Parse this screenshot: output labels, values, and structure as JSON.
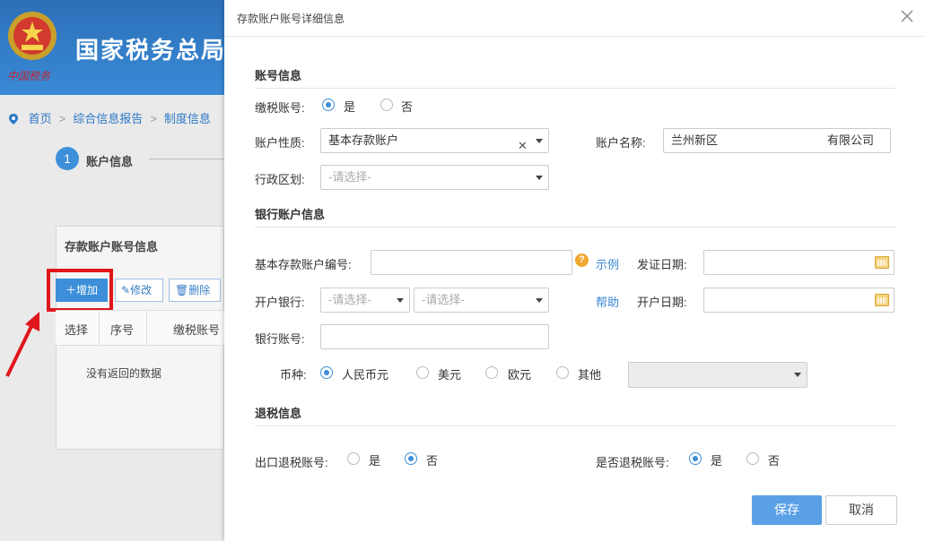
{
  "background": {
    "emblem_text": "中国税务",
    "bureau_title": "国家税务总局",
    "breadcrumb": [
      "首页",
      "综合信息报告",
      "制度信息"
    ],
    "step": {
      "number": "1",
      "label": "账户信息"
    },
    "panel_title": "存款账户账号信息",
    "toolbar": {
      "add": "增加",
      "edit": "修改",
      "delete": "删除"
    },
    "table_headers": [
      "选择",
      "序号",
      "缴税账号"
    ],
    "empty_message": "没有返回的数据",
    "colors": {
      "header_blue": "#2c6fb8",
      "highlight_red": "#e0161d"
    }
  },
  "modal": {
    "title": "存款账户账号详细信息",
    "sections": {
      "account": "账号信息",
      "bank": "银行账户信息",
      "refund": "退税信息"
    },
    "tax_account": {
      "label": "缴税账号:",
      "options": [
        "是",
        "否"
      ],
      "selected": "是"
    },
    "account_type": {
      "label": "账户性质:",
      "value": "基本存款账户"
    },
    "account_name": {
      "label": "账户名称:",
      "value": "兰州新区",
      "suffix": "有限公司"
    },
    "admin_region": {
      "label": "行政区划:",
      "placeholder": "-请选择-"
    },
    "basic_account_no": {
      "label": "基本存款账户编号:",
      "value": ""
    },
    "example_link": "示例",
    "issue_date": {
      "label": "发证日期:",
      "value": ""
    },
    "opening_bank": {
      "label": "开户银行:",
      "placeholder1": "-请选择-",
      "placeholder2": "-请选择-"
    },
    "help_link": "帮助",
    "open_date": {
      "label": "开户日期:",
      "value": ""
    },
    "bank_account": {
      "label": "银行账号:",
      "value": ""
    },
    "currency": {
      "label": "币种:",
      "options": [
        "人民币元",
        "美元",
        "欧元",
        "其他"
      ],
      "selected": "人民币元"
    },
    "export_refund": {
      "label": "出口退税账号:",
      "options": [
        "是",
        "否"
      ],
      "selected": "否"
    },
    "is_refund": {
      "label": "是否退税账号:",
      "options": [
        "是",
        "否"
      ],
      "selected": "是"
    },
    "buttons": {
      "save": "保存",
      "cancel": "取消"
    },
    "colors": {
      "accent": "#3d8fd9",
      "save_button": "#5aa0e6",
      "calendar_icon": "#f4d27b"
    }
  }
}
